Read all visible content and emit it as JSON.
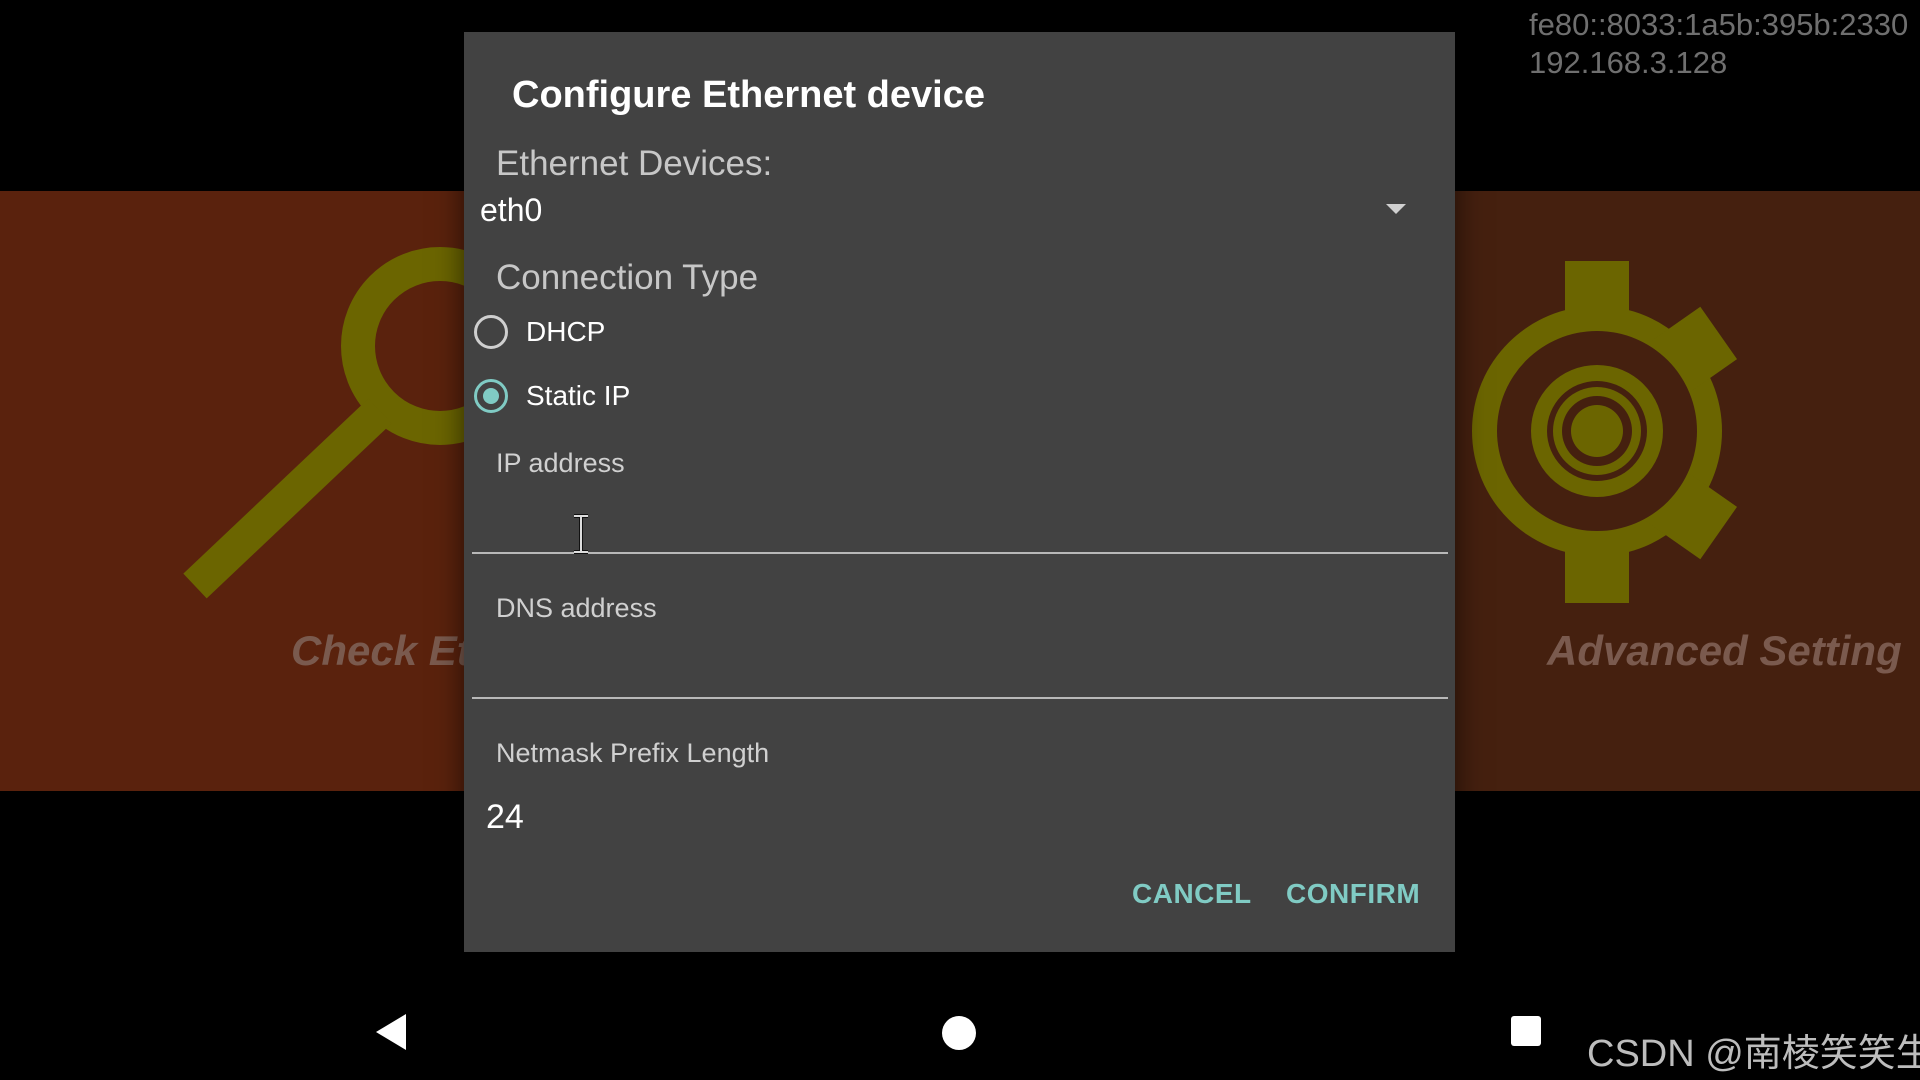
{
  "background": {
    "ip_info": {
      "ipv6": "fe80::8033:1a5b:395b:2330",
      "ipv4": "192.168.3.128"
    },
    "left_card": {
      "label": "Check Eth",
      "icon": "magnifier-icon"
    },
    "right_card": {
      "label": "Advanced Setting",
      "icon": "gear-icon"
    }
  },
  "dialog": {
    "title": "Configure Ethernet device",
    "devices_label": "Ethernet Devices:",
    "device_selected": "eth0",
    "connection_type_label": "Connection Type",
    "options": [
      {
        "label": "DHCP",
        "checked": false
      },
      {
        "label": "Static IP",
        "checked": true
      }
    ],
    "fields": {
      "ip_address": {
        "label": "IP address",
        "value": ""
      },
      "dns_address": {
        "label": "DNS address",
        "value": ""
      },
      "netmask": {
        "label": "Netmask Prefix Length",
        "value": "24"
      }
    },
    "buttons": {
      "cancel": "CANCEL",
      "confirm": "CONFIRM"
    }
  },
  "navbar": {
    "back": "back-icon",
    "home": "home-icon",
    "recent": "recents-icon"
  },
  "watermark": "CSDN @南棱笑笑生",
  "colors": {
    "accent": "#80cbc4",
    "dialog_bg": "#424242",
    "left_card_bg": "#5a220d",
    "right_card_bg": "#45200f",
    "icon_olive": "#6b6500"
  }
}
